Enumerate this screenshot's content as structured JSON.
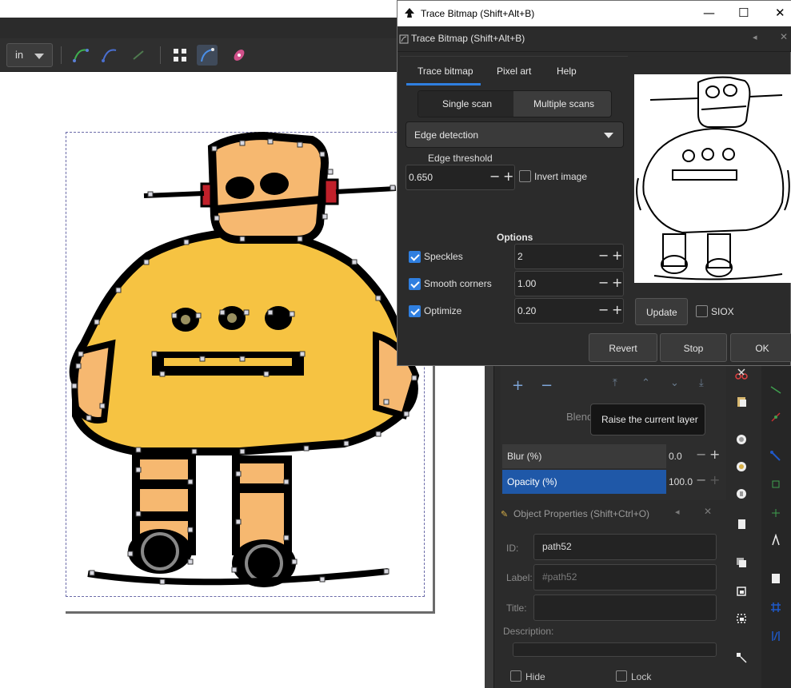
{
  "dialog": {
    "window_title": "Trace Bitmap (Shift+Alt+B)",
    "header_title": "Trace Bitmap (Shift+Alt+B)",
    "tabs": [
      {
        "label": "Trace bitmap",
        "active": true
      },
      {
        "label": "Pixel art",
        "active": false
      },
      {
        "label": "Help",
        "active": false
      }
    ],
    "scan_modes": {
      "single": "Single scan",
      "multi": "Multiple scans",
      "selected": "single"
    },
    "mode": "Edge detection",
    "edge_threshold_label": "Edge threshold",
    "edge_threshold_value": "0.650",
    "invert_image_label": "Invert image",
    "invert_image_checked": false,
    "options_title": "Options",
    "options": [
      {
        "label": "Speckles",
        "checked": true,
        "value": "2"
      },
      {
        "label": "Smooth corners",
        "checked": true,
        "value": "1.00"
      },
      {
        "label": "Optimize",
        "checked": true,
        "value": "0.20"
      }
    ],
    "update_label": "Update",
    "siox_label": "SIOX",
    "siox_checked": false,
    "buttons": {
      "revert": "Revert",
      "stop": "Stop",
      "ok": "OK"
    },
    "window_controls": {
      "minimize": "—",
      "maximize": "☐",
      "close": "✕"
    },
    "accent_color": "#2f7fe0"
  },
  "toolbar": {
    "unit": "in"
  },
  "layers": {
    "add_symbol": "+",
    "remove_symbol": "−",
    "blend_label": "Blend",
    "tooltip": "Raise the current layer"
  },
  "filters": [
    {
      "label": "Blur (%)",
      "value": "0.0",
      "selected": false
    },
    {
      "label": "Opacity (%)",
      "value": "100.0",
      "selected": true
    }
  ],
  "object_properties": {
    "title": "Object Properties (Shift+Ctrl+O)",
    "id_label": "ID:",
    "id_value": "path52",
    "label_label": "Label:",
    "label_placeholder": "#path52",
    "title_label": "Title:",
    "title_value": "",
    "description_label": "Description:",
    "hide_label": "Hide",
    "lock_label": "Lock"
  }
}
